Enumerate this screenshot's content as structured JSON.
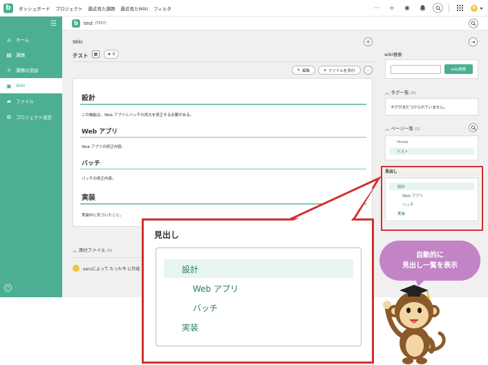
{
  "topbar": {
    "logo": "b",
    "nav": [
      "ダッシュボード",
      "プロジェクト",
      "最近見た課題",
      "最近見たWiki",
      "フィルタ"
    ],
    "icons": [
      "more-icon",
      "plus-icon",
      "eye-icon",
      "bell-icon",
      "search-icon",
      "apps-icon",
      "user-avatar-icon"
    ]
  },
  "sidebar": {
    "items": [
      {
        "label": "ホーム",
        "icon": "home-icon"
      },
      {
        "label": "課題",
        "icon": "list-icon"
      },
      {
        "label": "課題の追加",
        "icon": "plus-icon"
      },
      {
        "label": "Wiki",
        "icon": "wiki-icon",
        "active": true
      },
      {
        "label": "ファイル",
        "icon": "folder-icon"
      },
      {
        "label": "プロジェクト設定",
        "icon": "gear-icon"
      }
    ]
  },
  "project": {
    "logo": "b",
    "name": "test",
    "key": "(TEST)"
  },
  "wiki": {
    "breadcrumb": "Wiki",
    "title": "テスト",
    "star_count": "0",
    "edit_label": "編集",
    "attach_label": "ファイルを添付",
    "sections": [
      {
        "heading": "設計",
        "body": "この機能は、Web アプリとバッチの両方を修正する必要がある。"
      },
      {
        "heading": "Web アプリ",
        "body": "Web アプリの修正内容。"
      },
      {
        "heading": "バッチ",
        "body": "バッチの修正内容。"
      },
      {
        "heading": "実装",
        "body": "実装中に気づいたこと。"
      }
    ],
    "attachments_label": "添付ファイル",
    "attachments_count": "(0)",
    "creator_text": "saruによって たった今 に作成"
  },
  "right_panel": {
    "search_title": "wiki検索",
    "search_button": "wiki検索",
    "tags_label": "タグ一覧",
    "tags_count": "(0)",
    "tags_empty": "タグがまだつけられていません。",
    "pages_label": "ページ一覧",
    "pages_count": "(2)",
    "pages": [
      "Home",
      "テスト"
    ],
    "toc_title": "見出し",
    "toc": [
      "設計",
      "Web アプリ",
      "バッチ",
      "実装"
    ]
  },
  "callout": {
    "title": "見出し",
    "toc": [
      "設計",
      "Web アプリ",
      "バッチ",
      "実装"
    ],
    "bubble_line1": "自動的に",
    "bubble_line2": "見出し一覧を表示"
  },
  "colors": {
    "accent": "#4caf93",
    "highlight": "#d32f2f",
    "bubble": "#c384c6",
    "link": "#2a7a5f"
  }
}
